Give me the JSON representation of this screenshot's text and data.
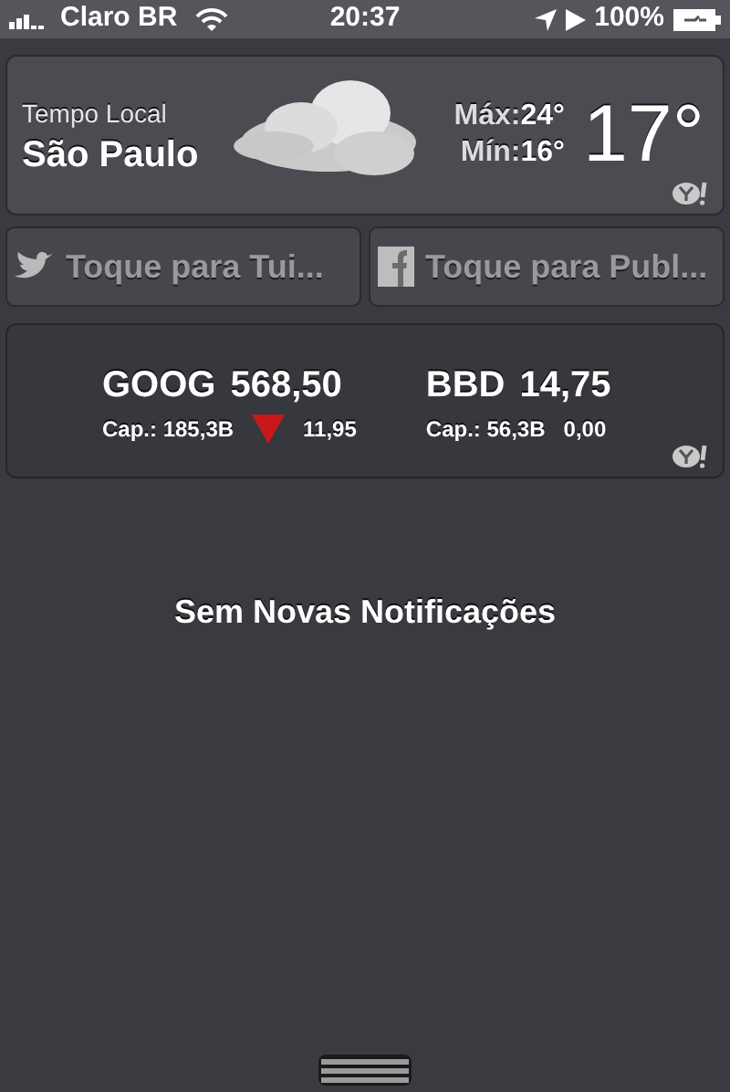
{
  "status_bar": {
    "carrier": "Claro BR",
    "time": "20:37",
    "battery": "100%"
  },
  "weather": {
    "label": "Tempo Local",
    "city": "São Paulo",
    "max_label": "Máx:",
    "max": "24°",
    "min_label": "Mín:",
    "min": "16°",
    "temp": "17°"
  },
  "social": [
    {
      "kind": "twitter",
      "label": "Toque para Tui..."
    },
    {
      "kind": "facebook",
      "label": "Toque para Publ..."
    }
  ],
  "stocks": [
    {
      "symbol": "GOOG",
      "price": "568,50",
      "cap": "Cap.: 185,3B",
      "change": "11,95",
      "kind": "down"
    },
    {
      "symbol": "BBD",
      "price": "14,75",
      "cap": "Cap.: 56,3B",
      "change": "0,00",
      "kind": "flat"
    }
  ],
  "empty_message": "Sem Novas Notificações"
}
